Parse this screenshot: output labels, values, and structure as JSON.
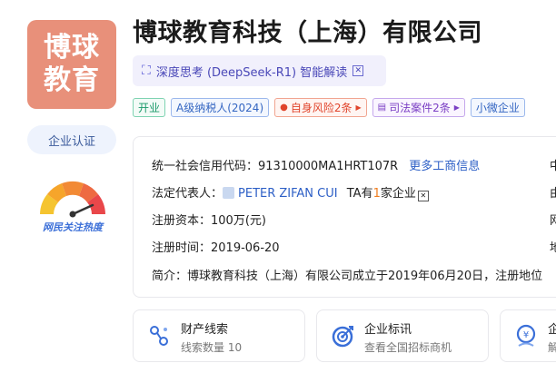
{
  "logo": {
    "line1": "博球",
    "line2": "教育"
  },
  "certification_button": "企业认证",
  "heat_label": "网民关注热度",
  "company_name": "博球教育科技（上海）有限公司",
  "ai_summary": {
    "label": "深度思考 (DeepSeek-R1) 智能解读",
    "icon": "ai-sparkle-icon",
    "accent": "#4a48b8"
  },
  "tags": [
    {
      "label": "开业",
      "style": "green"
    },
    {
      "label": "A级纳税人(2024)",
      "style": "blue"
    },
    {
      "label": "自身风险2条",
      "style": "red"
    },
    {
      "label": "司法案件2条",
      "style": "purple"
    },
    {
      "label": "小微企业",
      "style": "blue"
    }
  ],
  "info": {
    "credit_code_label": "统一社会信用代码：",
    "credit_code": "91310000MA1HRT107R",
    "more_link": "更多工商信息",
    "rep_label": "法定代表人：",
    "rep_name": "PETER ZIFAN CUI",
    "rep_ta_prefix": "TA有",
    "rep_ta_count": "1",
    "rep_ta_suffix": "家企业",
    "capital_label": "注册资本：",
    "capital": "100万(元)",
    "date_label": "注册时间：",
    "date": "2019-06-20",
    "intro_label": "简介：",
    "intro": "博球教育科技（上海）有限公司成立于2019年06月20日，注册地位",
    "side_chars": [
      "中",
      "由",
      "网",
      "地"
    ]
  },
  "bottom_cards": [
    {
      "title": "财产线索",
      "sub_prefix": "线索数量 ",
      "sub_value": "10",
      "icon": "property-clue-icon"
    },
    {
      "title": "企业标讯",
      "sub_prefix": "查看全国招标商机",
      "sub_value": "",
      "icon": "bidding-target-icon"
    },
    {
      "title": "企",
      "sub_prefix": "解",
      "sub_value": "",
      "icon": "money-person-icon"
    }
  ],
  "colors": {
    "brand_blue": "#2d5fc6",
    "logo_bg": "#e8907a"
  }
}
